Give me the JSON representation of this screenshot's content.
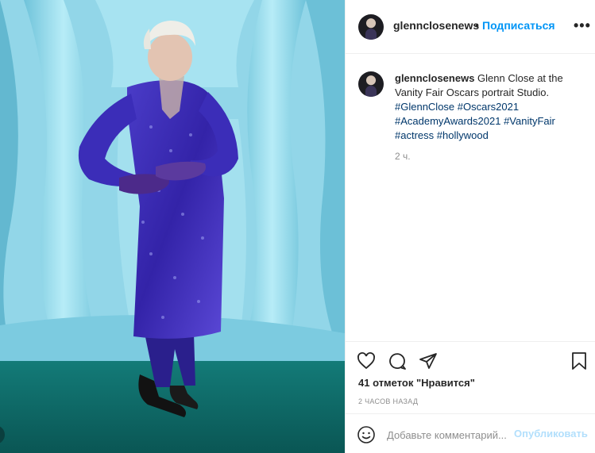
{
  "post": {
    "username": "glennclosenews",
    "header_separator": "•",
    "follow_label": "Подписаться",
    "more_label": "•••",
    "caption_text": "Glenn Close at the Vanity Fair Oscars portrait Studio.",
    "hashtags": [
      "#GlennClose",
      "#Oscars2021",
      "#AcademyAwards2021",
      "#VanityFair",
      "#actress",
      "#hollywood"
    ],
    "caption_age": "2 ч.",
    "likes_text": "41 отметок \"Нравится\"",
    "posted_ago": "2 ЧАСОВ НАЗАД"
  },
  "comment_box": {
    "placeholder": "Добавьте комментарий...",
    "publish_label": "Опубликовать"
  },
  "icons": {
    "like": "heart-icon",
    "comment": "comment-bubble-icon",
    "share": "paper-plane-icon",
    "save": "bookmark-icon",
    "emoji": "smiley-icon",
    "more": "more-options-icon"
  },
  "colors": {
    "link_blue": "#0095f6",
    "hashtag": "#00376b",
    "muted": "#8e8e8e",
    "publish_disabled": "#b2dffc",
    "backdrop": "#8fd3e6",
    "carpet": "#0f6b6a",
    "dress": "#3d2fb0"
  }
}
